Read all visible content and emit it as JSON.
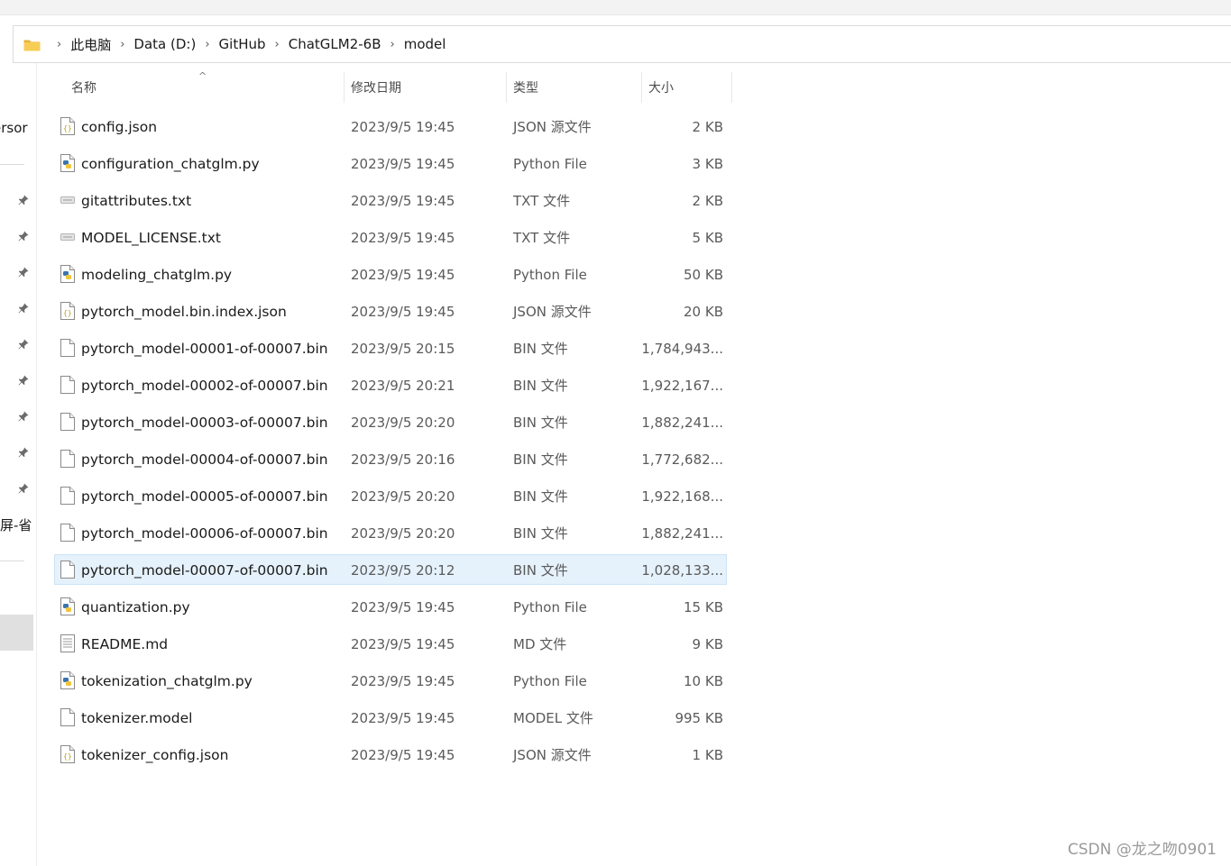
{
  "breadcrumb": {
    "items": [
      "此电脑",
      "Data (D:)",
      "GitHub",
      "ChatGLM2-6B",
      "model"
    ],
    "separator": "›"
  },
  "nav": {
    "partial_label_1": "ersor",
    "partial_label_2": "屏-省"
  },
  "columns": {
    "name": "名称",
    "date": "修改日期",
    "type": "类型",
    "size": "大小",
    "sort_indicator": "^"
  },
  "files": [
    {
      "name": "config.json",
      "date": "2023/9/5 19:45",
      "type": "JSON 源文件",
      "size": "2 KB",
      "icon": "json-file-icon"
    },
    {
      "name": "configuration_chatglm.py",
      "date": "2023/9/5 19:45",
      "type": "Python File",
      "size": "3 KB",
      "icon": "python-file-icon"
    },
    {
      "name": "gitattributes.txt",
      "date": "2023/9/5 19:45",
      "type": "TXT 文件",
      "size": "2 KB",
      "icon": "txt-file-icon"
    },
    {
      "name": "MODEL_LICENSE.txt",
      "date": "2023/9/5 19:45",
      "type": "TXT 文件",
      "size": "5 KB",
      "icon": "txt-file-icon"
    },
    {
      "name": "modeling_chatglm.py",
      "date": "2023/9/5 19:45",
      "type": "Python File",
      "size": "50 KB",
      "icon": "python-file-icon"
    },
    {
      "name": "pytorch_model.bin.index.json",
      "date": "2023/9/5 19:45",
      "type": "JSON 源文件",
      "size": "20 KB",
      "icon": "json-file-icon"
    },
    {
      "name": "pytorch_model-00001-of-00007.bin",
      "date": "2023/9/5 20:15",
      "type": "BIN 文件",
      "size": "1,784,943...",
      "icon": "blank-file-icon"
    },
    {
      "name": "pytorch_model-00002-of-00007.bin",
      "date": "2023/9/5 20:21",
      "type": "BIN 文件",
      "size": "1,922,167...",
      "icon": "blank-file-icon"
    },
    {
      "name": "pytorch_model-00003-of-00007.bin",
      "date": "2023/9/5 20:20",
      "type": "BIN 文件",
      "size": "1,882,241...",
      "icon": "blank-file-icon"
    },
    {
      "name": "pytorch_model-00004-of-00007.bin",
      "date": "2023/9/5 20:16",
      "type": "BIN 文件",
      "size": "1,772,682...",
      "icon": "blank-file-icon"
    },
    {
      "name": "pytorch_model-00005-of-00007.bin",
      "date": "2023/9/5 20:20",
      "type": "BIN 文件",
      "size": "1,922,168...",
      "icon": "blank-file-icon"
    },
    {
      "name": "pytorch_model-00006-of-00007.bin",
      "date": "2023/9/5 20:20",
      "type": "BIN 文件",
      "size": "1,882,241...",
      "icon": "blank-file-icon"
    },
    {
      "name": "pytorch_model-00007-of-00007.bin",
      "date": "2023/9/5 20:12",
      "type": "BIN 文件",
      "size": "1,028,133...",
      "icon": "blank-file-icon",
      "selected": true
    },
    {
      "name": "quantization.py",
      "date": "2023/9/5 19:45",
      "type": "Python File",
      "size": "15 KB",
      "icon": "python-file-icon"
    },
    {
      "name": "README.md",
      "date": "2023/9/5 19:45",
      "type": "MD 文件",
      "size": "9 KB",
      "icon": "md-file-icon"
    },
    {
      "name": "tokenization_chatglm.py",
      "date": "2023/9/5 19:45",
      "type": "Python File",
      "size": "10 KB",
      "icon": "python-file-icon"
    },
    {
      "name": "tokenizer.model",
      "date": "2023/9/5 19:45",
      "type": "MODEL 文件",
      "size": "995 KB",
      "icon": "blank-file-icon"
    },
    {
      "name": "tokenizer_config.json",
      "date": "2023/9/5 19:45",
      "type": "JSON 源文件",
      "size": "1 KB",
      "icon": "json-file-icon"
    }
  ],
  "watermark": "CSDN @龙之吻0901",
  "colors": {
    "selection_bg": "#e5f1fb",
    "selection_border": "#cce4f7",
    "folder_yellow": "#f4c64a"
  }
}
